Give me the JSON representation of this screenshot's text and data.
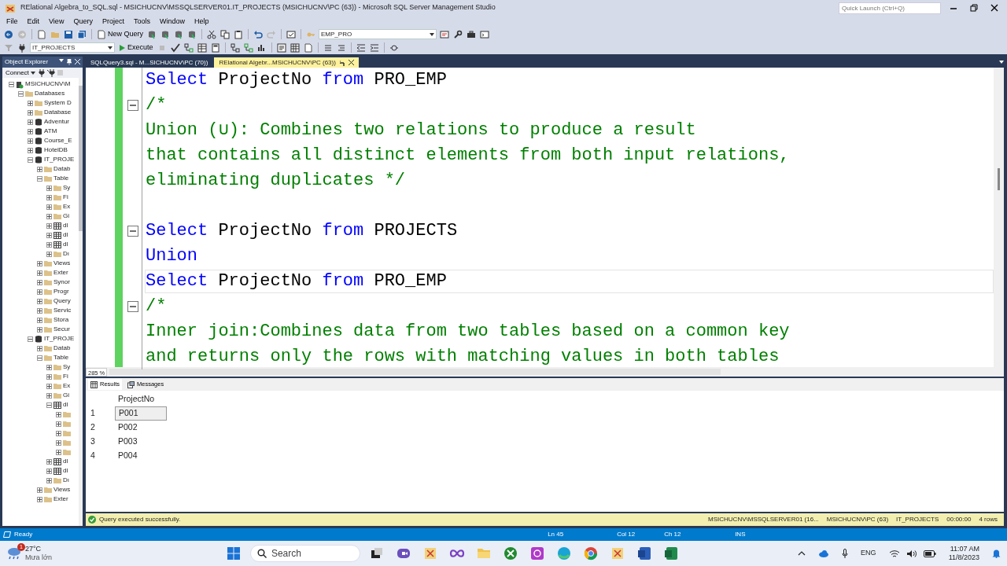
{
  "window": {
    "title": "RElational Algebra_to_SQL.sql - MSICHUCNV\\MSSQLSERVER01.IT_PROJECTS (MSICHUCNV\\PC (63)) - Microsoft SQL Server Management Studio",
    "quick_launch": {
      "placeholder": "Quick Launch (Ctrl+Q)"
    }
  },
  "menu": [
    "File",
    "Edit",
    "View",
    "Query",
    "Project",
    "Tools",
    "Window",
    "Help"
  ],
  "toolbar": {
    "new_query": "New Query",
    "object_combo": "EMP_PRO",
    "database_combo": "IT_PROJECTS",
    "execute": "Execute"
  },
  "object_explorer": {
    "title": "Object Explorer",
    "connect": "Connect",
    "tree": [
      {
        "label": "MSICHUCNV\\M",
        "kind": "server",
        "expanded": true,
        "children": [
          {
            "label": "Databases",
            "kind": "folder",
            "expanded": true,
            "children": [
              {
                "label": "System D",
                "kind": "folder",
                "expanded": false
              },
              {
                "label": "Database",
                "kind": "folder",
                "expanded": false
              },
              {
                "label": "Adventur",
                "kind": "database",
                "expanded": false
              },
              {
                "label": "ATM",
                "kind": "database",
                "expanded": false
              },
              {
                "label": "Course_E",
                "kind": "database",
                "expanded": false
              },
              {
                "label": "HotelDB",
                "kind": "database",
                "expanded": false
              },
              {
                "label": "IT_PROJE",
                "kind": "database",
                "expanded": true,
                "children": [
                  {
                    "label": "Datab",
                    "kind": "folder",
                    "expanded": false
                  },
                  {
                    "label": "Table",
                    "kind": "folder",
                    "expanded": true,
                    "children": [
                      {
                        "label": "Sy",
                        "kind": "folder",
                        "expanded": false
                      },
                      {
                        "label": "Fi",
                        "kind": "folder",
                        "expanded": false
                      },
                      {
                        "label": "Ex",
                        "kind": "folder",
                        "expanded": false
                      },
                      {
                        "label": "Gi",
                        "kind": "folder",
                        "expanded": false
                      },
                      {
                        "label": "dl",
                        "kind": "table",
                        "expanded": false
                      },
                      {
                        "label": "dl",
                        "kind": "table",
                        "expanded": false
                      },
                      {
                        "label": "dl",
                        "kind": "table",
                        "expanded": false
                      },
                      {
                        "label": "Dı",
                        "kind": "folder",
                        "expanded": false
                      }
                    ]
                  },
                  {
                    "label": "Views",
                    "kind": "folder",
                    "expanded": false
                  },
                  {
                    "label": "Exter",
                    "kind": "folder",
                    "expanded": false
                  },
                  {
                    "label": "Synor",
                    "kind": "folder",
                    "expanded": false
                  },
                  {
                    "label": "Progr",
                    "kind": "folder",
                    "expanded": false
                  },
                  {
                    "label": "Query",
                    "kind": "folder",
                    "expanded": false
                  },
                  {
                    "label": "Servic",
                    "kind": "folder",
                    "expanded": false
                  },
                  {
                    "label": "Stora",
                    "kind": "folder",
                    "expanded": false
                  },
                  {
                    "label": "Secur",
                    "kind": "folder",
                    "expanded": false
                  }
                ]
              },
              {
                "label": "IT_PROJE",
                "kind": "database",
                "expanded": true,
                "children": [
                  {
                    "label": "Datab",
                    "kind": "folder",
                    "expanded": false
                  },
                  {
                    "label": "Table",
                    "kind": "folder",
                    "expanded": true,
                    "children": [
                      {
                        "label": "Sy",
                        "kind": "folder",
                        "expanded": false
                      },
                      {
                        "label": "Fi",
                        "kind": "folder",
                        "expanded": false
                      },
                      {
                        "label": "Ex",
                        "kind": "folder",
                        "expanded": false
                      },
                      {
                        "label": "Gi",
                        "kind": "folder",
                        "expanded": false
                      },
                      {
                        "label": "dl",
                        "kind": "table",
                        "expanded": true,
                        "children": [
                          {
                            "kind": "folder",
                            "expanded": false
                          },
                          {
                            "kind": "folder",
                            "expanded": false
                          },
                          {
                            "kind": "folder",
                            "expanded": false
                          },
                          {
                            "kind": "folder",
                            "expanded": false
                          },
                          {
                            "kind": "folder",
                            "expanded": false
                          }
                        ]
                      },
                      {
                        "label": "dl",
                        "kind": "table",
                        "expanded": false
                      },
                      {
                        "label": "dl",
                        "kind": "table",
                        "expanded": false
                      },
                      {
                        "label": "Dı",
                        "kind": "folder",
                        "expanded": false
                      }
                    ]
                  },
                  {
                    "label": "Views",
                    "kind": "folder",
                    "expanded": false
                  },
                  {
                    "label": "Exter",
                    "kind": "folder",
                    "expanded": false
                  }
                ]
              }
            ]
          }
        ]
      }
    ]
  },
  "tabs": [
    {
      "label": "SQLQuery3.sql - M...SICHUCNV\\PC (70))",
      "selected": false
    },
    {
      "label": "RElational Algebr...MSICHUCNV\\PC (63))",
      "selected": true
    }
  ],
  "editor": {
    "zoom": "285 %",
    "lines": [
      {
        "fold": false,
        "current": false,
        "tokens": [
          {
            "text": "Select",
            "kind": "keyword"
          },
          {
            "text": "ProjectNo",
            "kind": "name"
          },
          {
            "text": "from",
            "kind": "keyword"
          },
          {
            "text": "PRO_EMP",
            "kind": "name"
          }
        ]
      },
      {
        "fold": true,
        "current": false,
        "tokens": [
          {
            "text": "/*",
            "kind": "comment"
          }
        ]
      },
      {
        "fold": false,
        "current": false,
        "tokens": [
          {
            "text": "Union (∪): Combines two relations to produce a result",
            "kind": "comment"
          }
        ]
      },
      {
        "fold": false,
        "current": false,
        "tokens": [
          {
            "text": "that contains all distinct elements from both input relations,",
            "kind": "comment"
          }
        ]
      },
      {
        "fold": false,
        "current": false,
        "tokens": [
          {
            "text": "eliminating duplicates */",
            "kind": "comment"
          }
        ]
      },
      {
        "fold": false,
        "current": false
      },
      {
        "fold": true,
        "current": false,
        "tokens": [
          {
            "text": "Select",
            "kind": "keyword"
          },
          {
            "text": "ProjectNo",
            "kind": "name"
          },
          {
            "text": "from",
            "kind": "keyword"
          },
          {
            "text": "PROJECTS",
            "kind": "name"
          }
        ]
      },
      {
        "fold": false,
        "current": false,
        "tokens": [
          {
            "text": "Union",
            "kind": "keyword"
          }
        ]
      },
      {
        "fold": false,
        "current": true,
        "tokens": [
          {
            "text": "Select",
            "kind": "keyword"
          },
          {
            "text": "ProjectNo",
            "kind": "name"
          },
          {
            "text": "from",
            "kind": "keyword"
          },
          {
            "text": "PRO_EMP",
            "kind": "name"
          }
        ]
      },
      {
        "fold": true,
        "current": false,
        "tokens": [
          {
            "text": "/*",
            "kind": "comment"
          }
        ]
      },
      {
        "fold": false,
        "current": false,
        "tokens": [
          {
            "text": "Inner join:Combines data from two tables based on a common key",
            "kind": "comment"
          }
        ]
      },
      {
        "fold": false,
        "current": false,
        "tokens": [
          {
            "text": "and returns only the rows with matching values in both tables",
            "kind": "comment"
          }
        ]
      }
    ]
  },
  "results": {
    "tabs": [
      {
        "label": "Results",
        "selected": true
      },
      {
        "label": "Messages",
        "selected": false
      }
    ],
    "columns": [
      "ProjectNo"
    ],
    "rows": [
      {
        "number": "1",
        "cells": [
          "P001"
        ],
        "selected": true
      },
      {
        "number": "2",
        "cells": [
          "P002"
        ],
        "selected": false
      },
      {
        "number": "3",
        "cells": [
          "P003"
        ],
        "selected": false
      },
      {
        "number": "4",
        "cells": [
          "P004"
        ],
        "selected": false
      }
    ]
  },
  "query_status": {
    "message": "Query executed successfully.",
    "items": [
      "MSICHUCNV\\MSSQLSERVER01 (16...",
      "MSICHUCNV\\PC (63)",
      "IT_PROJECTS",
      "00:00:00",
      "4 rows"
    ]
  },
  "status_bar": {
    "state": "Ready",
    "items": [
      "Ln 45",
      "Col 12",
      "Ch 12",
      "INS"
    ]
  },
  "taskbar": {
    "weather": {
      "badge": "1",
      "temperature": "27°C",
      "condition": "Mưa lớn"
    },
    "search": {
      "placeholder": "Search"
    },
    "language": "ENG",
    "time": "11:07 AM",
    "date": "11/8/2023"
  }
}
